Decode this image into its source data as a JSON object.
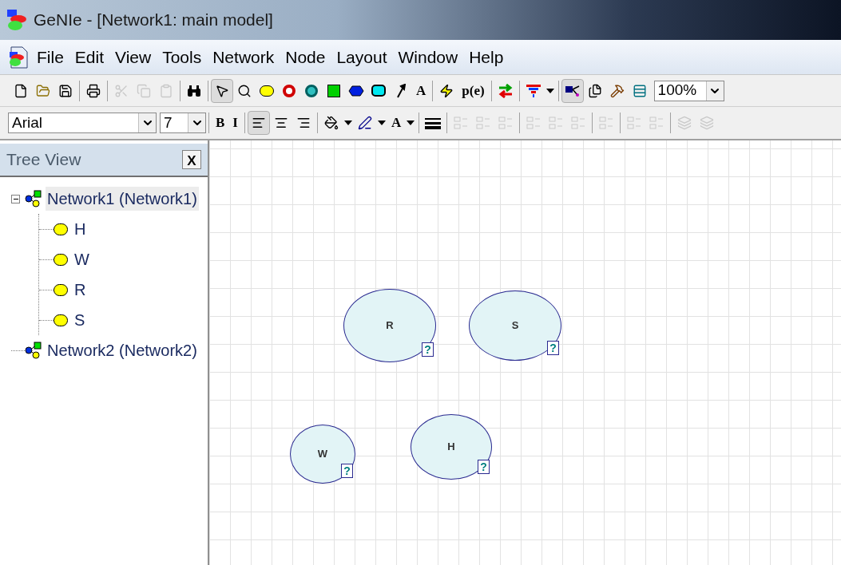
{
  "window": {
    "title": "GeNIe - [Network1: main model]"
  },
  "menu": [
    "File",
    "Edit",
    "View",
    "Tools",
    "Network",
    "Node",
    "Layout",
    "Window",
    "Help"
  ],
  "toolbar_main": [
    {
      "kind": "new",
      "disabled": false,
      "selected": false
    },
    {
      "kind": "open",
      "disabled": false,
      "selected": false
    },
    {
      "kind": "save",
      "disabled": false,
      "selected": false
    },
    {
      "kind": "sep"
    },
    {
      "kind": "print",
      "disabled": false,
      "selected": false
    },
    {
      "kind": "sep"
    },
    {
      "kind": "cut",
      "disabled": true,
      "selected": false
    },
    {
      "kind": "copy",
      "disabled": true,
      "selected": false
    },
    {
      "kind": "paste",
      "disabled": true,
      "selected": false
    },
    {
      "kind": "sep"
    },
    {
      "kind": "find",
      "disabled": false,
      "selected": false
    },
    {
      "kind": "sep"
    },
    {
      "kind": "pointer",
      "disabled": false,
      "selected": true
    },
    {
      "kind": "zoom",
      "disabled": false,
      "selected": false
    },
    {
      "kind": "chance",
      "disabled": false,
      "selected": false
    },
    {
      "kind": "deterministic",
      "disabled": false,
      "selected": false
    },
    {
      "kind": "equation",
      "disabled": false,
      "selected": false
    },
    {
      "kind": "decision",
      "disabled": false,
      "selected": false
    },
    {
      "kind": "utility",
      "disabled": false,
      "selected": false
    },
    {
      "kind": "submodel",
      "disabled": false,
      "selected": false
    },
    {
      "kind": "arc",
      "disabled": false,
      "selected": false
    },
    {
      "kind": "text",
      "label": "A",
      "disabled": false,
      "selected": false
    },
    {
      "kind": "sep"
    },
    {
      "kind": "lightning",
      "disabled": false,
      "selected": false
    },
    {
      "kind": "text",
      "label": "p(e)",
      "disabled": false,
      "selected": false
    },
    {
      "kind": "sep"
    },
    {
      "kind": "swap",
      "disabled": false,
      "selected": false
    },
    {
      "kind": "sep"
    },
    {
      "kind": "funnel",
      "disabled": false,
      "selected": false
    },
    {
      "kind": "dropdown",
      "disabled": false,
      "selected": false
    },
    {
      "kind": "sep"
    },
    {
      "kind": "graph",
      "disabled": false,
      "selected": true
    },
    {
      "kind": "pages",
      "disabled": false,
      "selected": false
    },
    {
      "kind": "hammer",
      "disabled": false,
      "selected": false
    },
    {
      "kind": "sheet",
      "disabled": false,
      "selected": false
    }
  ],
  "zoom_combo": {
    "value": "100%"
  },
  "font_combo": {
    "value": "Arial"
  },
  "size_combo": {
    "value": "7"
  },
  "toolbar_format": [
    {
      "kind": "sep"
    },
    {
      "kind": "text",
      "label": "B",
      "disabled": false,
      "selected": false
    },
    {
      "kind": "text",
      "label": "I",
      "disabled": false,
      "selected": false
    },
    {
      "kind": "sep"
    },
    {
      "kind": "align-left",
      "disabled": false,
      "selected": true
    },
    {
      "kind": "align-center",
      "disabled": false,
      "selected": false
    },
    {
      "kind": "align-right",
      "disabled": false,
      "selected": false
    },
    {
      "kind": "sep"
    },
    {
      "kind": "fill",
      "disabled": false,
      "selected": false
    },
    {
      "kind": "dropdown",
      "disabled": false,
      "selected": false
    },
    {
      "kind": "pen",
      "disabled": false,
      "selected": false
    },
    {
      "kind": "dropdown",
      "disabled": false,
      "selected": false
    },
    {
      "kind": "text",
      "label": "A",
      "disabled": false,
      "selected": false
    },
    {
      "kind": "dropdown",
      "disabled": false,
      "selected": false
    },
    {
      "kind": "sep"
    },
    {
      "kind": "line-width",
      "disabled": false,
      "selected": false
    },
    {
      "kind": "sep"
    },
    {
      "kind": "align-nodes",
      "disabled": true,
      "selected": false
    },
    {
      "kind": "align-nodes",
      "disabled": true,
      "selected": false
    },
    {
      "kind": "align-nodes",
      "disabled": true,
      "selected": false
    },
    {
      "kind": "sep"
    },
    {
      "kind": "align-nodes",
      "disabled": true,
      "selected": false
    },
    {
      "kind": "align-nodes",
      "disabled": true,
      "selected": false
    },
    {
      "kind": "align-nodes",
      "disabled": true,
      "selected": false
    },
    {
      "kind": "sep"
    },
    {
      "kind": "align-nodes",
      "disabled": true,
      "selected": false
    },
    {
      "kind": "sep"
    },
    {
      "kind": "align-nodes",
      "disabled": true,
      "selected": false
    },
    {
      "kind": "align-nodes",
      "disabled": true,
      "selected": false
    },
    {
      "kind": "sep"
    },
    {
      "kind": "layers",
      "disabled": true,
      "selected": false
    },
    {
      "kind": "layers",
      "disabled": true,
      "selected": false
    }
  ],
  "tree_view": {
    "title": "Tree View",
    "close": "X",
    "items": [
      {
        "label": "Network1 (Network1)",
        "selected": true,
        "expanded": true,
        "children": [
          {
            "label": "H"
          },
          {
            "label": "W"
          },
          {
            "label": "R"
          },
          {
            "label": "S"
          }
        ]
      },
      {
        "label": "Network2 (Network2)",
        "selected": false
      }
    ]
  },
  "canvas": {
    "nodes": [
      {
        "label": "R",
        "badge": "?"
      },
      {
        "label": "S",
        "badge": "?"
      },
      {
        "label": "W",
        "badge": "?"
      },
      {
        "label": "H",
        "badge": "?"
      }
    ]
  }
}
